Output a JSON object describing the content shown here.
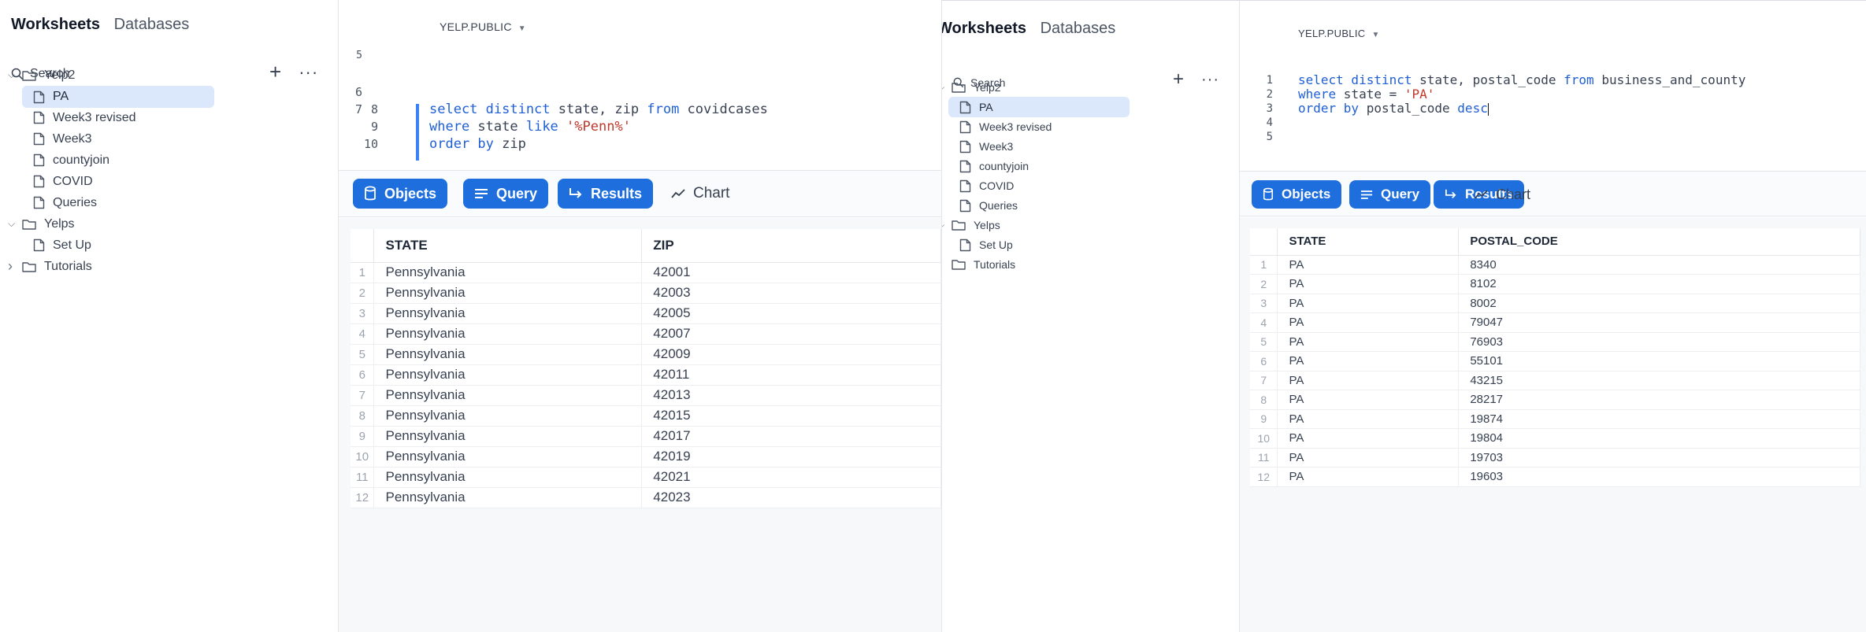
{
  "left": {
    "sidebar": {
      "tabs": [
        "Worksheets",
        "Databases"
      ],
      "search_label": "Search",
      "add_label": "+",
      "more_label": "···",
      "tree": [
        {
          "label": "Yelp2",
          "kind": "folder",
          "expanded": true
        },
        {
          "label": "PA",
          "kind": "worksheet",
          "selected": true
        },
        {
          "label": "Week3 revised",
          "kind": "worksheet"
        },
        {
          "label": "Week3",
          "kind": "worksheet"
        },
        {
          "label": "countyjoin",
          "kind": "worksheet"
        },
        {
          "label": "COVID",
          "kind": "worksheet"
        },
        {
          "label": "Queries",
          "kind": "worksheet"
        },
        {
          "label": "Yelps",
          "kind": "folder",
          "expanded": true
        },
        {
          "label": "Set Up",
          "kind": "worksheet"
        },
        {
          "label": "Tutorials",
          "kind": "folder",
          "expanded": false
        }
      ]
    },
    "context": "YELP.PUBLIC",
    "editor": {
      "line_numbers": [
        "6",
        "7",
        "8",
        "9",
        "10"
      ],
      "partial_line_number": "5",
      "partial_code": ";",
      "lines": [
        {
          "num": "8",
          "tokens": [
            {
              "t": "select distinct",
              "c": "kw"
            },
            {
              "t": " state, zip ",
              "c": "plain"
            },
            {
              "t": "from",
              "c": "kw"
            },
            {
              "t": " covidcases",
              "c": "plain"
            }
          ]
        },
        {
          "num": "9",
          "tokens": [
            {
              "t": "where",
              "c": "kw"
            },
            {
              "t": " state ",
              "c": "plain"
            },
            {
              "t": "like",
              "c": "kw"
            },
            {
              "t": " ",
              "c": "plain"
            },
            {
              "t": "'%Penn%'",
              "c": "str"
            }
          ]
        },
        {
          "num": "10",
          "tokens": [
            {
              "t": "order by",
              "c": "kw"
            },
            {
              "t": " zip",
              "c": "plain"
            }
          ]
        }
      ]
    },
    "toolbar": {
      "objects": "Objects",
      "query": "Query",
      "results": "Results",
      "chart": "Chart"
    },
    "table": {
      "columns": [
        "STATE",
        "ZIP"
      ],
      "rows": [
        [
          "1",
          "Pennsylvania",
          "42001"
        ],
        [
          "2",
          "Pennsylvania",
          "42003"
        ],
        [
          "3",
          "Pennsylvania",
          "42005"
        ],
        [
          "4",
          "Pennsylvania",
          "42007"
        ],
        [
          "5",
          "Pennsylvania",
          "42009"
        ],
        [
          "6",
          "Pennsylvania",
          "42011"
        ],
        [
          "7",
          "Pennsylvania",
          "42013"
        ],
        [
          "8",
          "Pennsylvania",
          "42015"
        ],
        [
          "9",
          "Pennsylvania",
          "42017"
        ],
        [
          "10",
          "Pennsylvania",
          "42019"
        ],
        [
          "11",
          "Pennsylvania",
          "42021"
        ],
        [
          "12",
          "Pennsylvania",
          "42023"
        ]
      ]
    }
  },
  "right": {
    "sidebar": {
      "tabs": [
        "Worksheets",
        "Databases"
      ],
      "search_label": "Search",
      "add_label": "+",
      "more_label": "···",
      "tree": [
        {
          "label": "Yelp2",
          "kind": "folder",
          "expanded": true
        },
        {
          "label": "PA",
          "kind": "worksheet",
          "selected": true
        },
        {
          "label": "Week3 revised",
          "kind": "worksheet"
        },
        {
          "label": "Week3",
          "kind": "worksheet"
        },
        {
          "label": "countyjoin",
          "kind": "worksheet"
        },
        {
          "label": "COVID",
          "kind": "worksheet"
        },
        {
          "label": "Queries",
          "kind": "worksheet"
        },
        {
          "label": "Yelps",
          "kind": "folder",
          "expanded": true
        },
        {
          "label": "Set Up",
          "kind": "worksheet"
        },
        {
          "label": "Tutorials",
          "kind": "folder",
          "expanded": false
        }
      ]
    },
    "context": "YELP.PUBLIC",
    "editor": {
      "lines": [
        {
          "num": "1",
          "tokens": [
            {
              "t": "select distinct",
              "c": "kw"
            },
            {
              "t": " state, postal_code ",
              "c": "plain"
            },
            {
              "t": "from",
              "c": "kw"
            },
            {
              "t": " business_and_county",
              "c": "plain"
            }
          ]
        },
        {
          "num": "2",
          "tokens": [
            {
              "t": "where",
              "c": "kw"
            },
            {
              "t": " state = ",
              "c": "plain"
            },
            {
              "t": "'PA'",
              "c": "str"
            }
          ]
        },
        {
          "num": "3",
          "tokens": [
            {
              "t": "order by",
              "c": "kw"
            },
            {
              "t": " postal_code ",
              "c": "plain"
            },
            {
              "t": "desc",
              "c": "kw"
            }
          ]
        },
        {
          "num": "4",
          "tokens": []
        },
        {
          "num": "5",
          "tokens": []
        }
      ]
    },
    "toolbar": {
      "objects": "Objects",
      "query": "Query",
      "results": "Results",
      "chart": "Chart"
    },
    "table": {
      "columns": [
        "STATE",
        "POSTAL_CODE"
      ],
      "rows": [
        [
          "1",
          "PA",
          "8340"
        ],
        [
          "2",
          "PA",
          "8102"
        ],
        [
          "3",
          "PA",
          "8002"
        ],
        [
          "4",
          "PA",
          "79047"
        ],
        [
          "5",
          "PA",
          "76903"
        ],
        [
          "6",
          "PA",
          "55101"
        ],
        [
          "7",
          "PA",
          "43215"
        ],
        [
          "8",
          "PA",
          "28217"
        ],
        [
          "9",
          "PA",
          "19874"
        ],
        [
          "10",
          "PA",
          "19804"
        ],
        [
          "11",
          "PA",
          "19703"
        ],
        [
          "12",
          "PA",
          "19603"
        ]
      ]
    }
  }
}
